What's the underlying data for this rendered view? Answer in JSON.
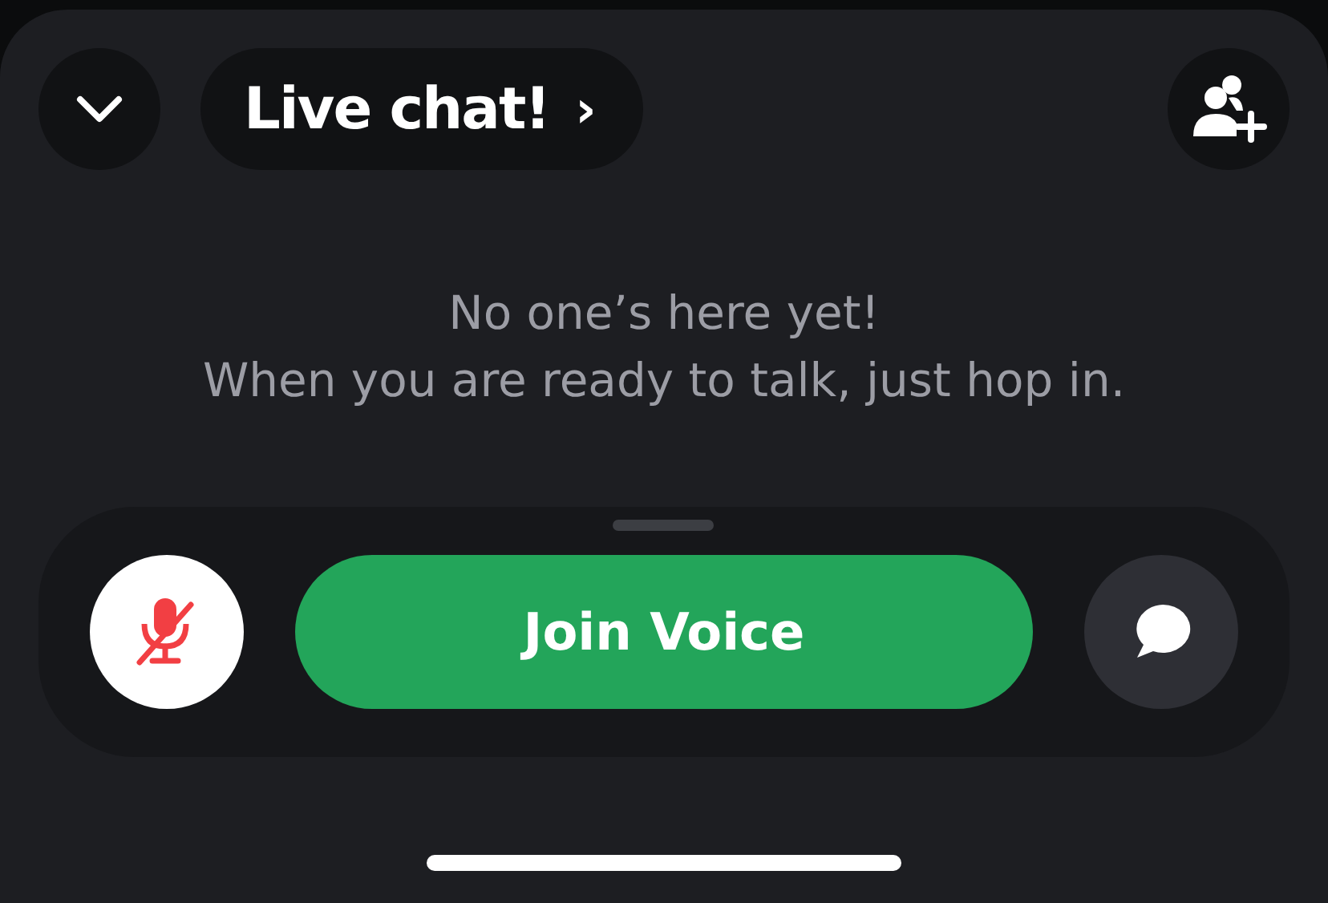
{
  "header": {
    "title": "Live chat!",
    "chevron": "›"
  },
  "empty_state": {
    "lines": [
      "No one’s here yet!",
      "When you are ready to talk, just hop in."
    ]
  },
  "controls": {
    "mic": {
      "muted": true
    },
    "join_button": "Join Voice"
  }
}
